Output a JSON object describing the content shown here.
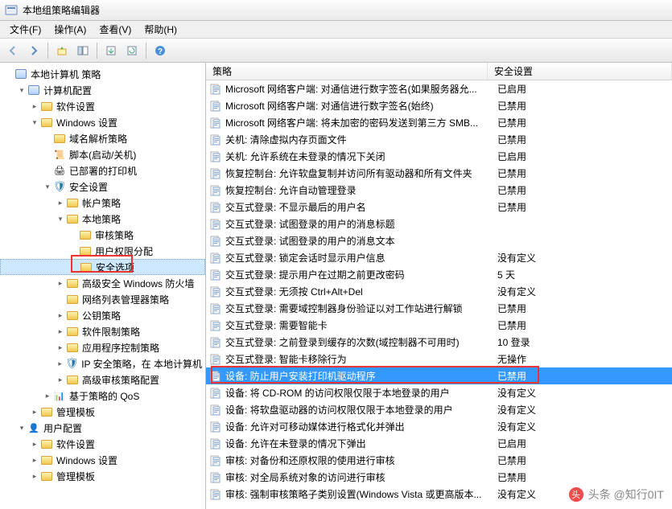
{
  "title": "本地组策略编辑器",
  "menu": {
    "file": "文件(F)",
    "action": "操作(A)",
    "view": "查看(V)",
    "help": "帮助(H)"
  },
  "toolbar_icons": [
    "back",
    "forward",
    "up",
    "show-hide",
    "export",
    "refresh",
    "help"
  ],
  "tree": [
    {
      "d": 0,
      "exp": "",
      "icon": "comp",
      "label": "本地计算机 策略"
    },
    {
      "d": 1,
      "exp": "▾",
      "icon": "comp",
      "label": "计算机配置"
    },
    {
      "d": 2,
      "exp": "▸",
      "icon": "folder",
      "label": "软件设置"
    },
    {
      "d": 2,
      "exp": "▾",
      "icon": "folder",
      "label": "Windows 设置"
    },
    {
      "d": 3,
      "exp": "",
      "icon": "folder",
      "label": "域名解析策略"
    },
    {
      "d": 3,
      "exp": "",
      "icon": "script",
      "label": "脚本(启动/关机)"
    },
    {
      "d": 3,
      "exp": "",
      "icon": "printer",
      "label": "已部署的打印机"
    },
    {
      "d": 3,
      "exp": "▾",
      "icon": "shield",
      "label": "安全设置"
    },
    {
      "d": 4,
      "exp": "▸",
      "icon": "folder",
      "label": "帐户策略"
    },
    {
      "d": 4,
      "exp": "▾",
      "icon": "folder",
      "label": "本地策略"
    },
    {
      "d": 5,
      "exp": "",
      "icon": "folder",
      "label": "审核策略"
    },
    {
      "d": 5,
      "exp": "",
      "icon": "folder",
      "label": "用户权限分配"
    },
    {
      "d": 5,
      "exp": "",
      "icon": "folder",
      "label": "安全选项",
      "sel": true
    },
    {
      "d": 4,
      "exp": "▸",
      "icon": "folder",
      "label": "高级安全 Windows 防火墙"
    },
    {
      "d": 4,
      "exp": "",
      "icon": "folder",
      "label": "网络列表管理器策略"
    },
    {
      "d": 4,
      "exp": "▸",
      "icon": "folder",
      "label": "公钥策略"
    },
    {
      "d": 4,
      "exp": "▸",
      "icon": "folder",
      "label": "软件限制策略"
    },
    {
      "d": 4,
      "exp": "▸",
      "icon": "folder",
      "label": "应用程序控制策略"
    },
    {
      "d": 4,
      "exp": "▸",
      "icon": "shield",
      "label": "IP 安全策略，在 本地计算机"
    },
    {
      "d": 4,
      "exp": "▸",
      "icon": "folder",
      "label": "高级审核策略配置"
    },
    {
      "d": 3,
      "exp": "▸",
      "icon": "qos",
      "label": "基于策略的 QoS"
    },
    {
      "d": 2,
      "exp": "▸",
      "icon": "folder",
      "label": "管理模板"
    },
    {
      "d": 1,
      "exp": "▾",
      "icon": "user",
      "label": "用户配置"
    },
    {
      "d": 2,
      "exp": "▸",
      "icon": "folder",
      "label": "软件设置"
    },
    {
      "d": 2,
      "exp": "▸",
      "icon": "folder",
      "label": "Windows 设置"
    },
    {
      "d": 2,
      "exp": "▸",
      "icon": "folder",
      "label": "管理模板"
    }
  ],
  "list_headers": {
    "policy": "策略",
    "setting": "安全设置"
  },
  "policies": [
    {
      "name": "Microsoft 网络客户端: 对通信进行数字签名(如果服务器允...",
      "val": "已启用"
    },
    {
      "name": "Microsoft 网络客户端: 对通信进行数字签名(始终)",
      "val": "已禁用"
    },
    {
      "name": "Microsoft 网络客户端: 将未加密的密码发送到第三方 SMB...",
      "val": "已禁用"
    },
    {
      "name": "关机: 清除虚拟内存页面文件",
      "val": "已禁用"
    },
    {
      "name": "关机: 允许系统在未登录的情况下关闭",
      "val": "已启用"
    },
    {
      "name": "恢复控制台: 允许软盘复制并访问所有驱动器和所有文件夹",
      "val": "已禁用"
    },
    {
      "name": "恢复控制台: 允许自动管理登录",
      "val": "已禁用"
    },
    {
      "name": "交互式登录: 不显示最后的用户名",
      "val": "已禁用"
    },
    {
      "name": "交互式登录: 试图登录的用户的消息标题",
      "val": ""
    },
    {
      "name": "交互式登录: 试图登录的用户的消息文本",
      "val": ""
    },
    {
      "name": "交互式登录: 锁定会话时显示用户信息",
      "val": "没有定义"
    },
    {
      "name": "交互式登录: 提示用户在过期之前更改密码",
      "val": "5 天"
    },
    {
      "name": "交互式登录: 无须按 Ctrl+Alt+Del",
      "val": "没有定义"
    },
    {
      "name": "交互式登录: 需要域控制器身份验证以对工作站进行解锁",
      "val": "已禁用"
    },
    {
      "name": "交互式登录: 需要智能卡",
      "val": "已禁用"
    },
    {
      "name": "交互式登录: 之前登录到缓存的次数(域控制器不可用时)",
      "val": "10 登录"
    },
    {
      "name": "交互式登录: 智能卡移除行为",
      "val": "无操作"
    },
    {
      "name": "设备: 防止用户安装打印机驱动程序",
      "val": "已禁用",
      "sel": true
    },
    {
      "name": "设备: 将 CD-ROM 的访问权限仅限于本地登录的用户",
      "val": "没有定义"
    },
    {
      "name": "设备: 将软盘驱动器的访问权限仅限于本地登录的用户",
      "val": "没有定义"
    },
    {
      "name": "设备: 允许对可移动媒体进行格式化并弹出",
      "val": "没有定义"
    },
    {
      "name": "设备: 允许在未登录的情况下弹出",
      "val": "已启用"
    },
    {
      "name": "审核: 对备份和还原权限的使用进行审核",
      "val": "已禁用"
    },
    {
      "name": "审核: 对全局系统对象的访问进行审核",
      "val": "已禁用"
    },
    {
      "name": "审核: 强制审核策略子类别设置(Windows Vista 或更高版本...",
      "val": "没有定义"
    }
  ],
  "watermark": "头条 @知行0IT"
}
